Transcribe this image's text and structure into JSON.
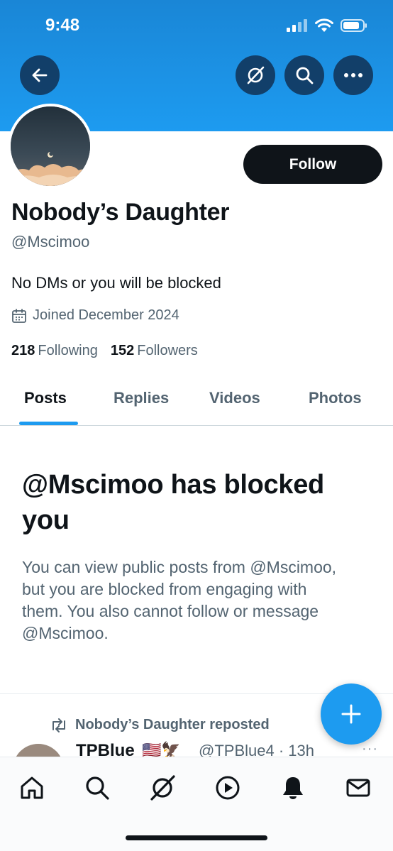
{
  "status_bar": {
    "time": "9:48"
  },
  "profile": {
    "display_name": "Nobody’s Daughter",
    "handle": "@Mscimoo",
    "bio": "No DMs or you will be blocked",
    "joined": "Joined December 2024",
    "following_count": "218",
    "following_label": "Following",
    "followers_count": "152",
    "followers_label": "Followers",
    "follow_label": "Follow"
  },
  "tabs": [
    {
      "label": "Posts",
      "active": true
    },
    {
      "label": "Replies",
      "active": false
    },
    {
      "label": "Videos",
      "active": false
    },
    {
      "label": "Photos",
      "active": false
    }
  ],
  "blocked_notice": {
    "title": "@Mscimoo has blocked you",
    "description": "You can view public posts from @Mscimoo, but you are blocked from engaging with them. You also cannot follow or message @Mscimoo."
  },
  "feed": {
    "repost_label": "Nobody’s Daughter reposted",
    "author": "TPBlue",
    "flags": "🇺🇸🦅",
    "meta": "@TPBlue4 · 13h",
    "more": "···"
  },
  "icons": {
    "back": "back-arrow-icon",
    "grok": "grok-icon",
    "search": "search-icon",
    "more": "more-icon",
    "calendar": "calendar-icon",
    "repost": "repost-icon",
    "compose": "plus-icon",
    "home": "home-icon",
    "nav_search": "search-icon",
    "nav_grok": "grok-icon",
    "video": "play-icon",
    "notifications": "bell-icon",
    "messages": "mail-icon"
  },
  "colors": {
    "banner": "#1d9bf0",
    "accent": "#1d9bf0",
    "text_primary": "#0f1419",
    "text_secondary": "#536471"
  }
}
